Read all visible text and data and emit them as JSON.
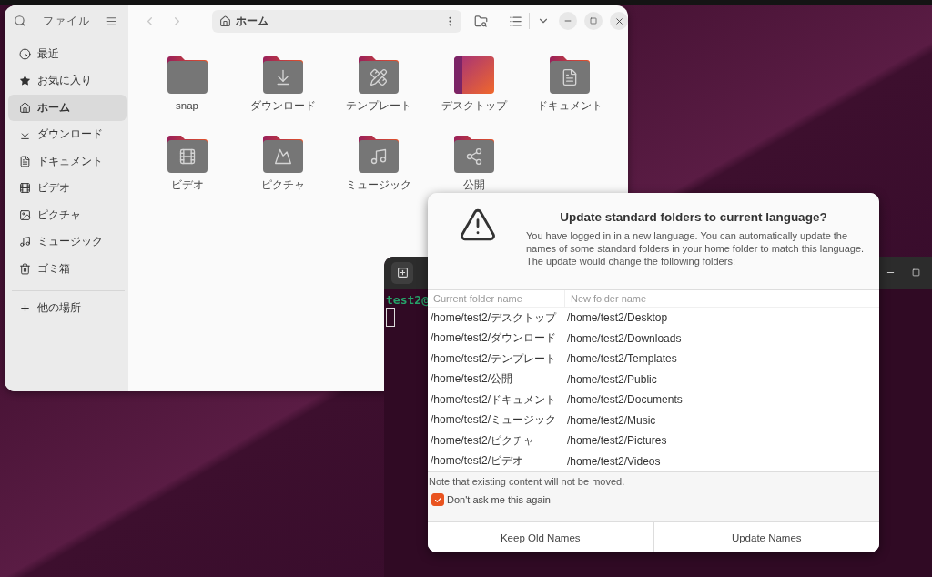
{
  "file_manager": {
    "title": "ファイル",
    "sidebar": [
      {
        "label": "最近",
        "kind": "recent",
        "selected": false
      },
      {
        "label": "お気に入り",
        "kind": "starred",
        "selected": false
      },
      {
        "label": "ホーム",
        "kind": "home",
        "selected": true
      },
      {
        "label": "ダウンロード",
        "kind": "downloads",
        "selected": false
      },
      {
        "label": "ドキュメント",
        "kind": "documents",
        "selected": false
      },
      {
        "label": "ビデオ",
        "kind": "videos",
        "selected": false
      },
      {
        "label": "ピクチャ",
        "kind": "pictures",
        "selected": false
      },
      {
        "label": "ミュージック",
        "kind": "music",
        "selected": false
      },
      {
        "label": "ゴミ箱",
        "kind": "trash",
        "selected": false
      }
    ],
    "other_places": "他の場所",
    "path": "ホーム",
    "folders": [
      {
        "name": "snap",
        "kind": "plain"
      },
      {
        "name": "ダウンロード",
        "kind": "downloads"
      },
      {
        "name": "テンプレート",
        "kind": "templates"
      },
      {
        "name": "デスクトップ",
        "kind": "desktop"
      },
      {
        "name": "ドキュメント",
        "kind": "documents"
      },
      {
        "name": "ビデオ",
        "kind": "videos"
      },
      {
        "name": "ピクチャ",
        "kind": "pictures"
      },
      {
        "name": "ミュージック",
        "kind": "music"
      },
      {
        "name": "公開",
        "kind": "public"
      }
    ]
  },
  "terminal": {
    "prompt": "test2@"
  },
  "dialog": {
    "title": "Update standard folders to current language?",
    "message": "You have logged in in a new language. You can automatically update the names of some standard folders in your home folder to match this language. The update would change the following folders:",
    "columns": [
      "Current folder name",
      "New folder name"
    ],
    "rows": [
      {
        "current": "/home/test2/デスクトップ",
        "new": "/home/test2/Desktop"
      },
      {
        "current": "/home/test2/ダウンロード",
        "new": "/home/test2/Downloads"
      },
      {
        "current": "/home/test2/テンプレート",
        "new": "/home/test2/Templates"
      },
      {
        "current": "/home/test2/公開",
        "new": "/home/test2/Public"
      },
      {
        "current": "/home/test2/ドキュメント",
        "new": "/home/test2/Documents"
      },
      {
        "current": "/home/test2/ミュージック",
        "new": "/home/test2/Music"
      },
      {
        "current": "/home/test2/ピクチャ",
        "new": "/home/test2/Pictures"
      },
      {
        "current": "/home/test2/ビデオ",
        "new": "/home/test2/Videos"
      }
    ],
    "note": "Note that existing content will not be moved.",
    "dont_ask": {
      "label": "Don't ask me this again",
      "checked": true
    },
    "buttons": [
      "Keep Old Names",
      "Update Names"
    ]
  }
}
